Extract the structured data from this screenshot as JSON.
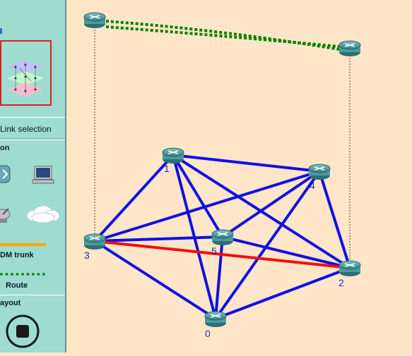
{
  "sidebar": {
    "link_selection_label": "Link selection",
    "section_label_partial": "on",
    "wdm_trunk_label": "DM trunk",
    "route_label": "Route",
    "layout_label": "ayout",
    "icons": {
      "layers": "multilayer-network-icon",
      "router": "router-icon",
      "computer": "computer-icon",
      "satellite": "satellite-icon",
      "cloud": "cloud-icon",
      "stop": "stop-icon"
    },
    "selected_frame_color": "#e02020",
    "wdm_trunk_color": "#ffa500",
    "route_color": "#1a8a1a"
  },
  "graph": {
    "node_labels": [
      "0",
      "1",
      "2",
      "3",
      "4",
      "5"
    ],
    "link_color": "#1010e0",
    "selected_link_color": "#ee1010",
    "route_color": "#008000"
  }
}
